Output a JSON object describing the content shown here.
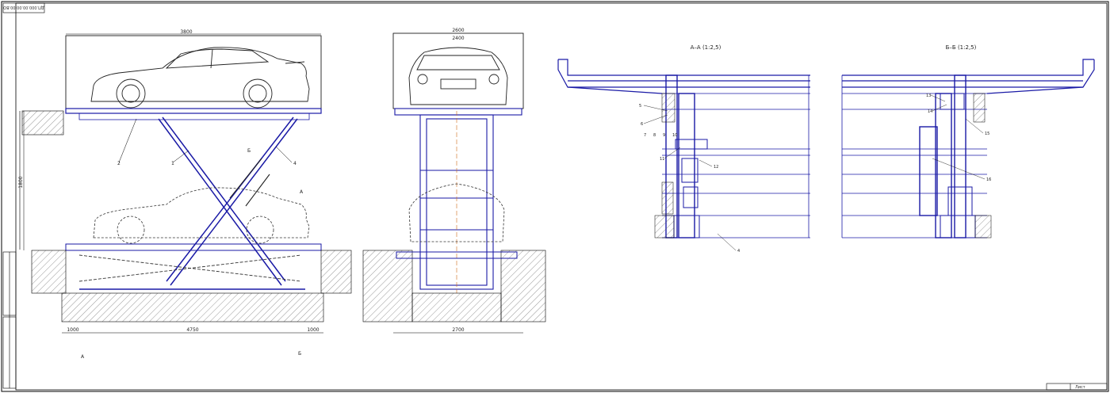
{
  "sheet": {
    "stamp_code": "ДП.000.00.00.00.ВО",
    "frame_color": "#000000",
    "steel_color": "#1a1aa6",
    "axis_color": "#d06a18"
  },
  "views": {
    "side_view": {
      "top_dim": "3800",
      "height_dim": "1800",
      "base_left_dim": "1000",
      "base_span_dim": "4750",
      "base_right_dim": "1000",
      "part_labels": [
        "2",
        "1",
        "4"
      ],
      "section_marks": [
        "Б",
        "Б",
        "А",
        "А"
      ]
    },
    "front_view": {
      "top_dim": "2600",
      "top_inner_dim": "2400",
      "base_dim": "2700"
    },
    "section_a": {
      "title": "А–А (1:2,5)",
      "leaders": [
        "5",
        "6",
        "7",
        "8",
        "9",
        "10",
        "11",
        "12",
        "4"
      ]
    },
    "section_b": {
      "title": "Б–Б (1:2,5)",
      "leaders": [
        "13",
        "14",
        "15",
        "16"
      ]
    }
  },
  "title_block": {
    "sheet_label": "Лист"
  }
}
